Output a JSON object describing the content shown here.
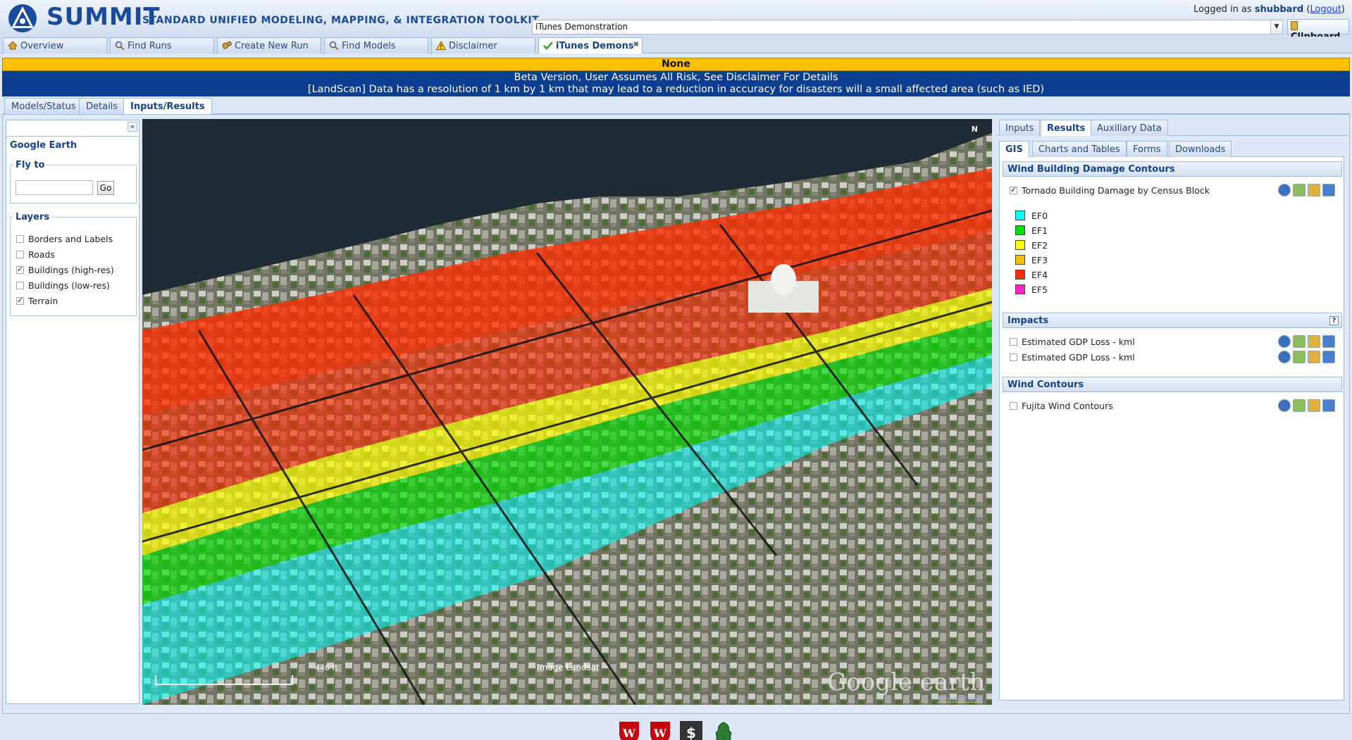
{
  "header": {
    "logo_text": "SUMMIT",
    "subtitle": "STANDARD UNIFIED MODELING, MAPPING, & INTEGRATION TOOLKIT",
    "login_prefix": "Logged in as",
    "username": "shubbard",
    "logout_label": "Logout",
    "run_selector_value": "iTunes Demonstration",
    "clipboard_label": "Clipboard"
  },
  "main_tabs": [
    {
      "label": "Overview",
      "icon": "home-icon"
    },
    {
      "label": "Find Runs",
      "icon": "magnifier-icon"
    },
    {
      "label": "Create New Run",
      "icon": "gears-icon"
    },
    {
      "label": "Find Models",
      "icon": "magnifier-icon"
    },
    {
      "label": "Disclaimer",
      "icon": "warning-icon"
    },
    {
      "label": "iTunes Demons",
      "icon": "check-icon",
      "active": true
    }
  ],
  "banners": {
    "status": "None",
    "beta_line1": "Beta Version, User Assumes All Risk, See Disclaimer For Details",
    "beta_line2": "[LandScan] Data has a resolution of 1 km by 1 km that may lead to a reduction in accuracy for disasters will a small affected area (such as IED)"
  },
  "sub_tabs": [
    {
      "label": "Models/Status"
    },
    {
      "label": "Details"
    },
    {
      "label": "Inputs/Results",
      "active": true
    }
  ],
  "left_panel": {
    "title": "Google Earth",
    "fly_to_legend": "Fly to",
    "fly_to_placeholder": "",
    "go_label": "Go",
    "layers_legend": "Layers",
    "layers": [
      {
        "label": "Borders and Labels",
        "checked": false
      },
      {
        "label": "Roads",
        "checked": false
      },
      {
        "label": "Buildings (high-res)",
        "checked": true
      },
      {
        "label": "Buildings (low-res)",
        "checked": false
      },
      {
        "label": "Terrain",
        "checked": true
      }
    ]
  },
  "map": {
    "compass": "N",
    "scale_label": "446 ft",
    "imagery_label": "Image Landsat",
    "logo": "Google earth",
    "terms": "Terms of Use"
  },
  "right_panel": {
    "tabs": [
      {
        "label": "Inputs"
      },
      {
        "label": "Results",
        "active": true
      },
      {
        "label": "Auxiliary Data"
      }
    ],
    "subtabs": [
      {
        "label": "GIS",
        "active": true
      },
      {
        "label": "Charts and Tables"
      },
      {
        "label": "Forms"
      },
      {
        "label": "Downloads"
      }
    ],
    "wind_damage": {
      "title": "Wind Building Damage Contours",
      "layer_label": "Tornado Building Damage by Census Block",
      "legend": [
        {
          "label": "EF0",
          "color": "#00ffff"
        },
        {
          "label": "EF1",
          "color": "#00e000"
        },
        {
          "label": "EF2",
          "color": "#ffff00"
        },
        {
          "label": "EF3",
          "color": "#ffc000"
        },
        {
          "label": "EF4",
          "color": "#ff2a00"
        },
        {
          "label": "EF5",
          "color": "#ff22cc"
        }
      ]
    },
    "impacts": {
      "title": "Impacts",
      "help": "?",
      "layers": [
        {
          "label": "Estimated GDP Loss - kml"
        },
        {
          "label": "Estimated GDP Loss - kml"
        }
      ]
    },
    "wind_contours": {
      "title": "Wind Contours",
      "layer_label": "Fujita Wind Contours"
    }
  }
}
